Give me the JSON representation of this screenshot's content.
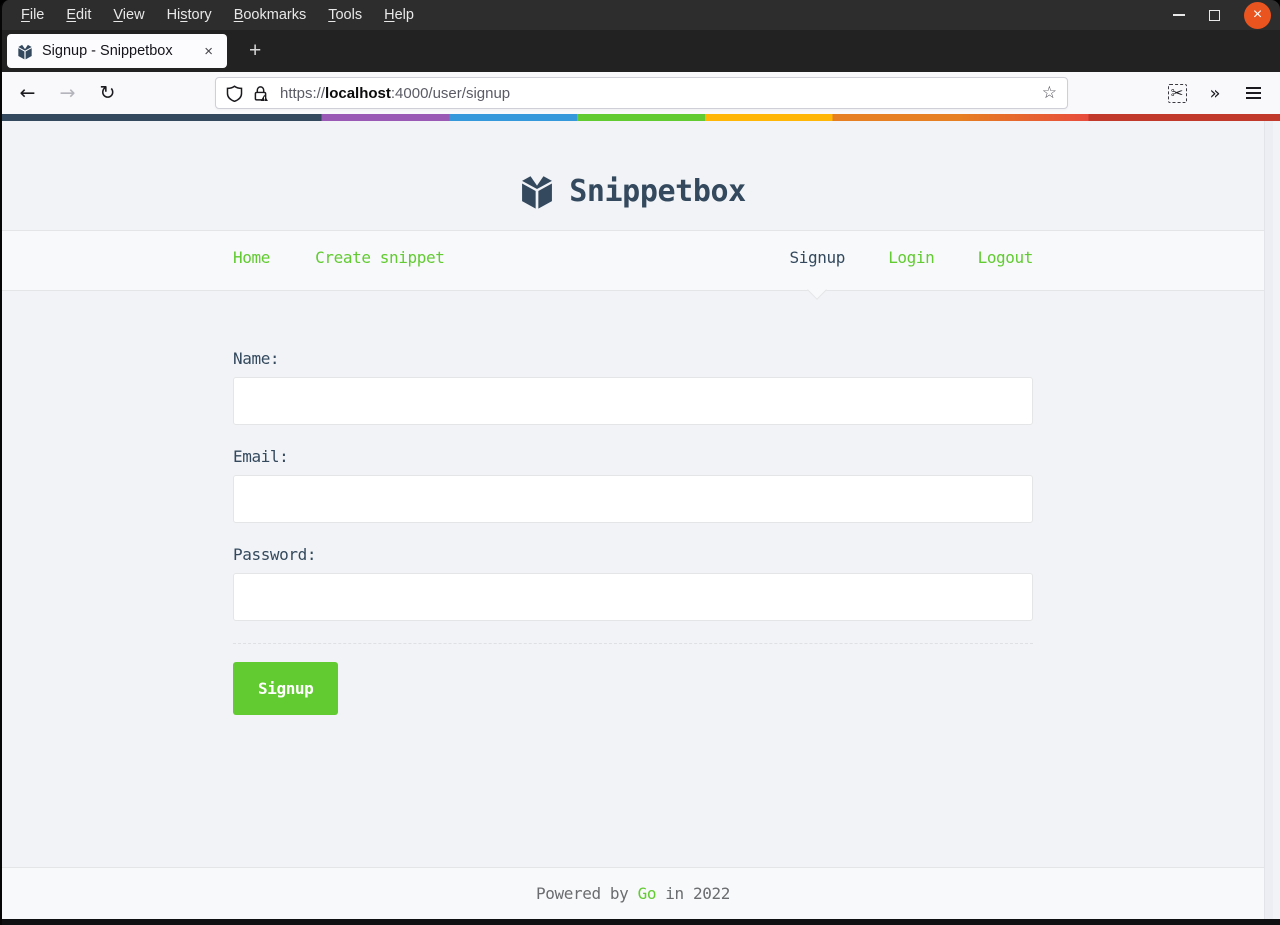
{
  "menubar": {
    "items": [
      {
        "pre": "",
        "accel": "F",
        "post": "ile"
      },
      {
        "pre": "",
        "accel": "E",
        "post": "dit"
      },
      {
        "pre": "",
        "accel": "V",
        "post": "iew"
      },
      {
        "pre": "Hi",
        "accel": "s",
        "post": "tory"
      },
      {
        "pre": "",
        "accel": "B",
        "post": "ookmarks"
      },
      {
        "pre": "",
        "accel": "T",
        "post": "ools"
      },
      {
        "pre": "",
        "accel": "H",
        "post": "elp"
      }
    ]
  },
  "tab": {
    "title": "Signup - Snippetbox",
    "close_glyph": "×",
    "new_tab_glyph": "+"
  },
  "toolbar": {
    "icons": {
      "back": "←",
      "forward": "→",
      "reload": "↻",
      "star": "☆",
      "screenshot": "✂",
      "overflow": "»"
    },
    "url": {
      "scheme": "https://",
      "host": "localhost",
      "rest": ":4000/user/signup"
    }
  },
  "page": {
    "brand": "Snippetbox",
    "nav_left": [
      {
        "label": "Home"
      },
      {
        "label": "Create snippet"
      }
    ],
    "nav_right": [
      {
        "label": "Signup",
        "active": true
      },
      {
        "label": "Login"
      },
      {
        "label": "Logout"
      }
    ],
    "form": {
      "fields": [
        {
          "label": "Name:",
          "value": ""
        },
        {
          "label": "Email:",
          "value": ""
        },
        {
          "label": "Password:",
          "value": ""
        }
      ],
      "submit_label": "Signup"
    },
    "footer": {
      "prefix": "Powered by ",
      "link": "Go",
      "suffix": " in 2022"
    }
  },
  "colors": {
    "navy": "#34495E",
    "green": "#62CB31",
    "page_bg": "#F1F3F6",
    "panel_bg": "#F7F9FA",
    "border": "#E4E5E7",
    "muted_text": "#6A6C6F",
    "close_button": "#E9541F",
    "stripe": [
      "#34495e",
      "#9b59b6",
      "#3498db",
      "#62cb31",
      "#ffb606",
      "#e67e22",
      "#e74c3c",
      "#c0392b"
    ]
  }
}
